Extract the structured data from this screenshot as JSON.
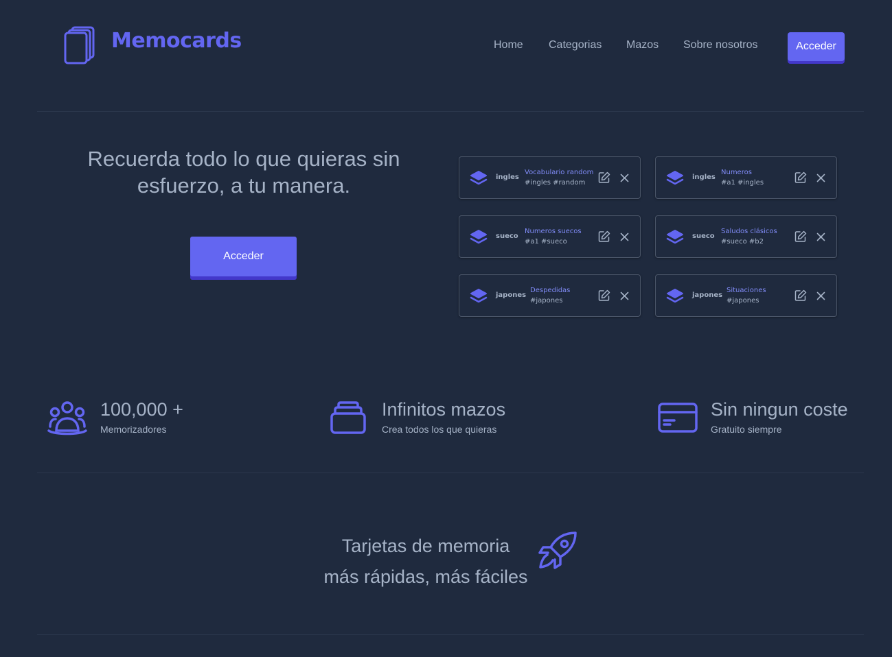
{
  "brand": {
    "name": "Memocards",
    "logo_icon": "cards-stack-icon",
    "accent_color": "#6366f1"
  },
  "nav": {
    "links": [
      "Home",
      "Categorias",
      "Mazos",
      "Sobre nosotros"
    ],
    "cta_label": "Acceder"
  },
  "hero": {
    "title_line1": "Recuerda todo lo que quieras sin",
    "title_line2": "esfuerzo, a tu manera.",
    "cta_label": "Acceder"
  },
  "decks": [
    {
      "category": "ingles",
      "name": "Vocabulario random",
      "tags": "#ingles  #random",
      "icon": "layers-icon"
    },
    {
      "category": "ingles",
      "name": "Numeros",
      "tags": "#a1  #ingles",
      "icon": "layers-icon"
    },
    {
      "category": "sueco",
      "name": "Numeros suecos",
      "tags": "#a1  #sueco",
      "icon": "layers-icon"
    },
    {
      "category": "sueco",
      "name": "Saludos clásicos",
      "tags": "#sueco  #b2",
      "icon": "layers-icon"
    },
    {
      "category": "japones",
      "name": "Despedidas",
      "tags": "#japones",
      "icon": "layers-icon"
    },
    {
      "category": "japones",
      "name": "Situaciones",
      "tags": "#japones",
      "icon": "layers-icon"
    }
  ],
  "stats": [
    {
      "title": "100,000 +",
      "subtitle": "Memorizadores",
      "icon": "users-group-icon"
    },
    {
      "title": "Infinitos mazos",
      "subtitle": "Crea todos los que quieras",
      "icon": "stack-icon"
    },
    {
      "title": "Sin ningun coste",
      "subtitle": "Gratuito siempre",
      "icon": "credit-card-icon"
    }
  ],
  "tagline": {
    "line1": "Tarjetas de memoria",
    "line2": "más rápidas, más fáciles",
    "icon": "rocket-icon"
  }
}
